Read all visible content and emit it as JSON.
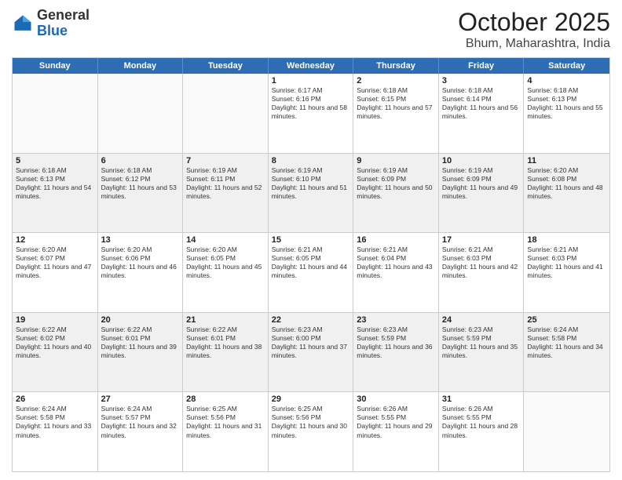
{
  "header": {
    "logo_general": "General",
    "logo_blue": "Blue",
    "month": "October 2025",
    "location": "Bhum, Maharashtra, India"
  },
  "days_of_week": [
    "Sunday",
    "Monday",
    "Tuesday",
    "Wednesday",
    "Thursday",
    "Friday",
    "Saturday"
  ],
  "rows": [
    {
      "cells": [
        {
          "day": "",
          "empty": true
        },
        {
          "day": "",
          "empty": true
        },
        {
          "day": "",
          "empty": true
        },
        {
          "day": "1",
          "sunrise": "Sunrise: 6:17 AM",
          "sunset": "Sunset: 6:16 PM",
          "daylight": "Daylight: 11 hours and 58 minutes."
        },
        {
          "day": "2",
          "sunrise": "Sunrise: 6:18 AM",
          "sunset": "Sunset: 6:15 PM",
          "daylight": "Daylight: 11 hours and 57 minutes."
        },
        {
          "day": "3",
          "sunrise": "Sunrise: 6:18 AM",
          "sunset": "Sunset: 6:14 PM",
          "daylight": "Daylight: 11 hours and 56 minutes."
        },
        {
          "day": "4",
          "sunrise": "Sunrise: 6:18 AM",
          "sunset": "Sunset: 6:13 PM",
          "daylight": "Daylight: 11 hours and 55 minutes."
        }
      ]
    },
    {
      "cells": [
        {
          "day": "5",
          "sunrise": "Sunrise: 6:18 AM",
          "sunset": "Sunset: 6:13 PM",
          "daylight": "Daylight: 11 hours and 54 minutes."
        },
        {
          "day": "6",
          "sunrise": "Sunrise: 6:18 AM",
          "sunset": "Sunset: 6:12 PM",
          "daylight": "Daylight: 11 hours and 53 minutes."
        },
        {
          "day": "7",
          "sunrise": "Sunrise: 6:19 AM",
          "sunset": "Sunset: 6:11 PM",
          "daylight": "Daylight: 11 hours and 52 minutes."
        },
        {
          "day": "8",
          "sunrise": "Sunrise: 6:19 AM",
          "sunset": "Sunset: 6:10 PM",
          "daylight": "Daylight: 11 hours and 51 minutes."
        },
        {
          "day": "9",
          "sunrise": "Sunrise: 6:19 AM",
          "sunset": "Sunset: 6:09 PM",
          "daylight": "Daylight: 11 hours and 50 minutes."
        },
        {
          "day": "10",
          "sunrise": "Sunrise: 6:19 AM",
          "sunset": "Sunset: 6:09 PM",
          "daylight": "Daylight: 11 hours and 49 minutes."
        },
        {
          "day": "11",
          "sunrise": "Sunrise: 6:20 AM",
          "sunset": "Sunset: 6:08 PM",
          "daylight": "Daylight: 11 hours and 48 minutes."
        }
      ]
    },
    {
      "cells": [
        {
          "day": "12",
          "sunrise": "Sunrise: 6:20 AM",
          "sunset": "Sunset: 6:07 PM",
          "daylight": "Daylight: 11 hours and 47 minutes."
        },
        {
          "day": "13",
          "sunrise": "Sunrise: 6:20 AM",
          "sunset": "Sunset: 6:06 PM",
          "daylight": "Daylight: 11 hours and 46 minutes."
        },
        {
          "day": "14",
          "sunrise": "Sunrise: 6:20 AM",
          "sunset": "Sunset: 6:05 PM",
          "daylight": "Daylight: 11 hours and 45 minutes."
        },
        {
          "day": "15",
          "sunrise": "Sunrise: 6:21 AM",
          "sunset": "Sunset: 6:05 PM",
          "daylight": "Daylight: 11 hours and 44 minutes."
        },
        {
          "day": "16",
          "sunrise": "Sunrise: 6:21 AM",
          "sunset": "Sunset: 6:04 PM",
          "daylight": "Daylight: 11 hours and 43 minutes."
        },
        {
          "day": "17",
          "sunrise": "Sunrise: 6:21 AM",
          "sunset": "Sunset: 6:03 PM",
          "daylight": "Daylight: 11 hours and 42 minutes."
        },
        {
          "day": "18",
          "sunrise": "Sunrise: 6:21 AM",
          "sunset": "Sunset: 6:03 PM",
          "daylight": "Daylight: 11 hours and 41 minutes."
        }
      ]
    },
    {
      "cells": [
        {
          "day": "19",
          "sunrise": "Sunrise: 6:22 AM",
          "sunset": "Sunset: 6:02 PM",
          "daylight": "Daylight: 11 hours and 40 minutes."
        },
        {
          "day": "20",
          "sunrise": "Sunrise: 6:22 AM",
          "sunset": "Sunset: 6:01 PM",
          "daylight": "Daylight: 11 hours and 39 minutes."
        },
        {
          "day": "21",
          "sunrise": "Sunrise: 6:22 AM",
          "sunset": "Sunset: 6:01 PM",
          "daylight": "Daylight: 11 hours and 38 minutes."
        },
        {
          "day": "22",
          "sunrise": "Sunrise: 6:23 AM",
          "sunset": "Sunset: 6:00 PM",
          "daylight": "Daylight: 11 hours and 37 minutes."
        },
        {
          "day": "23",
          "sunrise": "Sunrise: 6:23 AM",
          "sunset": "Sunset: 5:59 PM",
          "daylight": "Daylight: 11 hours and 36 minutes."
        },
        {
          "day": "24",
          "sunrise": "Sunrise: 6:23 AM",
          "sunset": "Sunset: 5:59 PM",
          "daylight": "Daylight: 11 hours and 35 minutes."
        },
        {
          "day": "25",
          "sunrise": "Sunrise: 6:24 AM",
          "sunset": "Sunset: 5:58 PM",
          "daylight": "Daylight: 11 hours and 34 minutes."
        }
      ]
    },
    {
      "cells": [
        {
          "day": "26",
          "sunrise": "Sunrise: 6:24 AM",
          "sunset": "Sunset: 5:58 PM",
          "daylight": "Daylight: 11 hours and 33 minutes."
        },
        {
          "day": "27",
          "sunrise": "Sunrise: 6:24 AM",
          "sunset": "Sunset: 5:57 PM",
          "daylight": "Daylight: 11 hours and 32 minutes."
        },
        {
          "day": "28",
          "sunrise": "Sunrise: 6:25 AM",
          "sunset": "Sunset: 5:56 PM",
          "daylight": "Daylight: 11 hours and 31 minutes."
        },
        {
          "day": "29",
          "sunrise": "Sunrise: 6:25 AM",
          "sunset": "Sunset: 5:56 PM",
          "daylight": "Daylight: 11 hours and 30 minutes."
        },
        {
          "day": "30",
          "sunrise": "Sunrise: 6:26 AM",
          "sunset": "Sunset: 5:55 PM",
          "daylight": "Daylight: 11 hours and 29 minutes."
        },
        {
          "day": "31",
          "sunrise": "Sunrise: 6:26 AM",
          "sunset": "Sunset: 5:55 PM",
          "daylight": "Daylight: 11 hours and 28 minutes."
        },
        {
          "day": "",
          "empty": true
        }
      ]
    }
  ]
}
